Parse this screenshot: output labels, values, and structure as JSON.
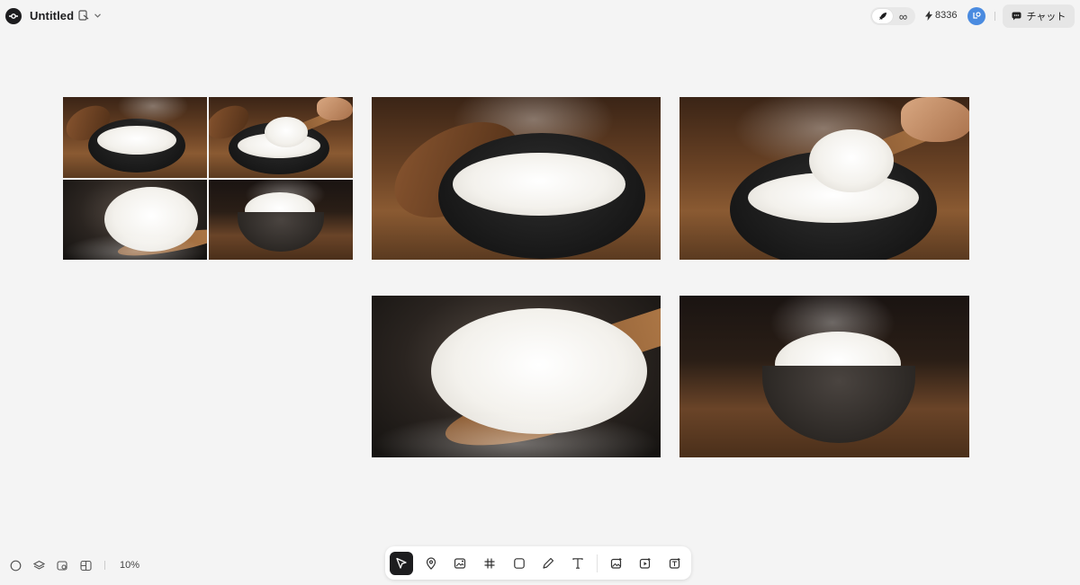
{
  "header": {
    "title": "Untitled",
    "credits": "8336",
    "infinity_symbol": "∞",
    "chat_label": "チャット"
  },
  "icons": {
    "logo": "app-logo-icon",
    "file": "file-share-icon",
    "chevron": "chevron-down-icon",
    "rocket": "rocket-icon",
    "bolt": "lightning-icon",
    "avatar": "user-avatar-icon",
    "chat": "chat-bubble-icon"
  },
  "canvas": {
    "images": [
      {
        "name": "rice-collage-grid"
      },
      {
        "name": "rice-pot-with-lid"
      },
      {
        "name": "rice-scooped-from-pot"
      },
      {
        "name": "rice-on-wooden-spoon"
      },
      {
        "name": "rice-in-bowl"
      }
    ]
  },
  "bottom_left": {
    "zoom": "10%"
  },
  "toolbar": {
    "tools": [
      "select",
      "location",
      "image-generate",
      "frame",
      "shape",
      "pen",
      "text",
      "image-upscale",
      "video-generate",
      "text-to-image"
    ],
    "active": "select"
  },
  "colors": {
    "background": "#f4f4f4",
    "accent": "#1d1d1f",
    "avatar": "#4a8be0"
  }
}
